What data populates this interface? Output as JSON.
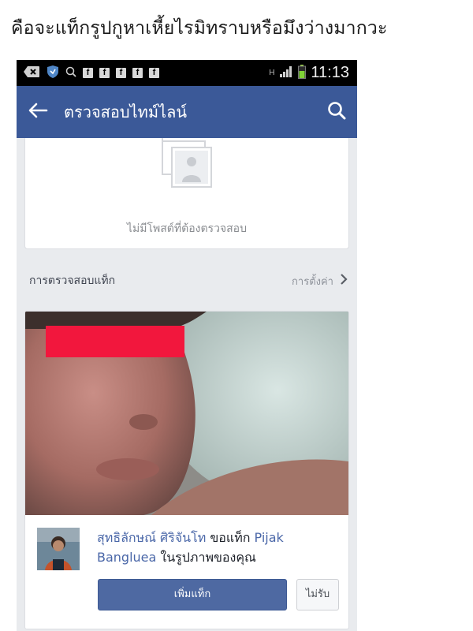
{
  "caption": "คือจะแท็กรูปกูหาเหี้ยไรมิทราบหรือมึงว่างมากวะ",
  "status_bar": {
    "time": "11:13",
    "fb_notification_glyph": "f",
    "network_label": "H"
  },
  "app_bar": {
    "title": "ตรวจสอบไทม์ไลน์",
    "back_icon": "arrow-left-icon",
    "search_icon": "search-icon"
  },
  "empty_state": {
    "icon": "photo-placeholder-icon",
    "text": "ไม่มีโพสต์ที่ต้องตรวจสอบ"
  },
  "tag_review": {
    "section_title": "การตรวจสอบแท็ก",
    "settings_label": "การตั้งค่า",
    "tag_request": {
      "requester_name": "สุทธิลักษณ์ ศิริจันโท",
      "action_text": "ขอแท็ก",
      "tagged_name": "Pijak Bangluea",
      "suffix_text": "ในรูปภาพของคุณ"
    },
    "add_tag_label": "เพิ่มแท็ก",
    "decline_label": "ไม่รับ"
  },
  "colors": {
    "facebook_blue": "#3b5998",
    "button_blue": "#4e69a2",
    "censor_red": "#f2173d",
    "background": "#e9ebee"
  }
}
